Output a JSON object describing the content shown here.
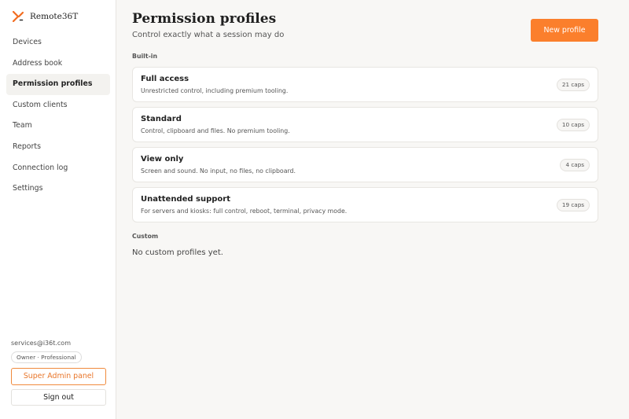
{
  "brand": {
    "name": "Remote36T",
    "accent": "#f26d21"
  },
  "sidebar": {
    "items": [
      {
        "label": "Devices",
        "active": false
      },
      {
        "label": "Address book",
        "active": false
      },
      {
        "label": "Permission profiles",
        "active": true
      },
      {
        "label": "Custom clients",
        "active": false
      },
      {
        "label": "Team",
        "active": false
      },
      {
        "label": "Reports",
        "active": false
      },
      {
        "label": "Connection log",
        "active": false
      },
      {
        "label": "Settings",
        "active": false
      }
    ],
    "user_email": "services@i36t.com",
    "role_badge": "Owner · Professional",
    "super_admin_label": "Super Admin panel",
    "sign_out_label": "Sign out"
  },
  "header": {
    "title": "Permission profiles",
    "subtitle": "Control exactly what a session may do",
    "new_profile_label": "New profile",
    "new_profile_color": "#fb7f2c"
  },
  "builtin": {
    "label": "Built-in",
    "profiles": [
      {
        "name": "Full access",
        "description": "Unrestricted control, including premium tooling.",
        "caps": "21 caps"
      },
      {
        "name": "Standard",
        "description": "Control, clipboard and files. No premium tooling.",
        "caps": "10 caps"
      },
      {
        "name": "View only",
        "description": "Screen and sound. No input, no files, no clipboard.",
        "caps": "4 caps"
      },
      {
        "name": "Unattended support",
        "description": "For servers and kiosks: full control, reboot, terminal, privacy mode.",
        "caps": "19 caps"
      }
    ]
  },
  "custom": {
    "label": "Custom",
    "empty_text": "No custom profiles yet."
  }
}
